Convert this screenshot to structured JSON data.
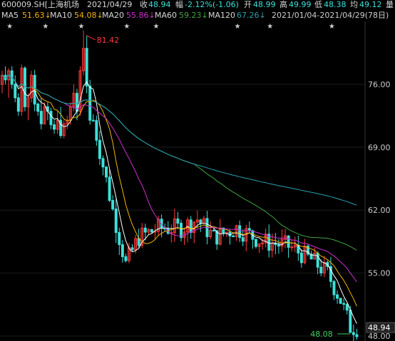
{
  "quote": {
    "code": "600009.SH[上海机场",
    "date": "2021/04/29",
    "close_label": "收",
    "close": "48.94",
    "change_label": "幅",
    "change": "-2.12%(-1.06)",
    "open_label": "开",
    "open": "48.99",
    "high_label": "高",
    "high": "49.99",
    "low_label": "低",
    "low": "48.38",
    "avg_label": "均",
    "avg": "49.12",
    "extra_label": "量"
  },
  "ma_legend": {
    "ma5": "MA5",
    "ma5_val": "51.63↓",
    "ma10": "MA10",
    "ma10_val": "54.08↓",
    "ma20": "MA20",
    "ma20_val": "55.86↓",
    "ma60": "MA60",
    "ma60_val": "59.23↓",
    "ma120": "MA120",
    "ma120_val": "67.26↓",
    "range": "2021/01/04-2021/04/29(78日)"
  },
  "colors": {
    "up": "#ff3b3b",
    "down": "#3ee0d8",
    "ma5": "#ffffff",
    "ma10": "#f0b400",
    "ma20": "#d030d0",
    "ma60": "#3fa53f",
    "ma120": "#2aa0b0",
    "grid": "#1c1c1c",
    "text": "#cccccc"
  },
  "chart_data": {
    "type": "candlestick",
    "ylim": [
      48.0,
      83.0
    ],
    "y_ticks": [
      "76.00",
      "69.00",
      "62.00",
      "55.00",
      "48.00"
    ],
    "y_tick_values": [
      76.0,
      69.0,
      62.0,
      55.0,
      48.0
    ],
    "last_price_label": "48.94",
    "last_price": 48.94,
    "max_label": "81.42",
    "max_value": 81.42,
    "min_label": "48.08",
    "min_value": 48.08,
    "star_markers": [
      "★",
      "★",
      "★",
      "★",
      "★",
      "★",
      "★",
      "★"
    ],
    "star_indices": [
      2,
      13,
      24,
      38,
      47,
      72,
      82,
      101
    ],
    "ohlc": [
      [
        76,
        77.5,
        75,
        77
      ],
      [
        77,
        78,
        76,
        76.5
      ],
      [
        76.5,
        77.8,
        74.5,
        77.5
      ],
      [
        77.5,
        78,
        75.5,
        76
      ],
      [
        76,
        77,
        74,
        74.5
      ],
      [
        74.5,
        75,
        72.5,
        73
      ],
      [
        73,
        78.2,
        72.5,
        77.8
      ],
      [
        77.8,
        78,
        73,
        73.5
      ],
      [
        73.5,
        75,
        72,
        74.5
      ],
      [
        74.5,
        77.5,
        74,
        77
      ],
      [
        77,
        77.6,
        73,
        73.8
      ],
      [
        73.8,
        74,
        72.5,
        73
      ],
      [
        73,
        74.5,
        71,
        71.6
      ],
      [
        71.6,
        74,
        71.5,
        73.5
      ],
      [
        73.5,
        74,
        72,
        73
      ],
      [
        73,
        73.4,
        71,
        71.5
      ],
      [
        71.5,
        72,
        70.5,
        71
      ],
      [
        71,
        73,
        70.5,
        72
      ],
      [
        72,
        73.5,
        70,
        70.3
      ],
      [
        70.3,
        72,
        70,
        71.6
      ],
      [
        71.6,
        72.5,
        71,
        72
      ],
      [
        72,
        74,
        71.5,
        73.5
      ],
      [
        73.5,
        76,
        73,
        75
      ],
      [
        75,
        75.5,
        72,
        73
      ],
      [
        73,
        78,
        72.5,
        77.5
      ],
      [
        77.5,
        82,
        77,
        80
      ],
      [
        80,
        81.42,
        75,
        75.8
      ],
      [
        75.8,
        76.5,
        71.5,
        72
      ]
    ],
    "ma_series": [
      "MA5",
      "MA10",
      "MA20",
      "MA60",
      "MA120"
    ],
    "ma_x_count": 110
  }
}
